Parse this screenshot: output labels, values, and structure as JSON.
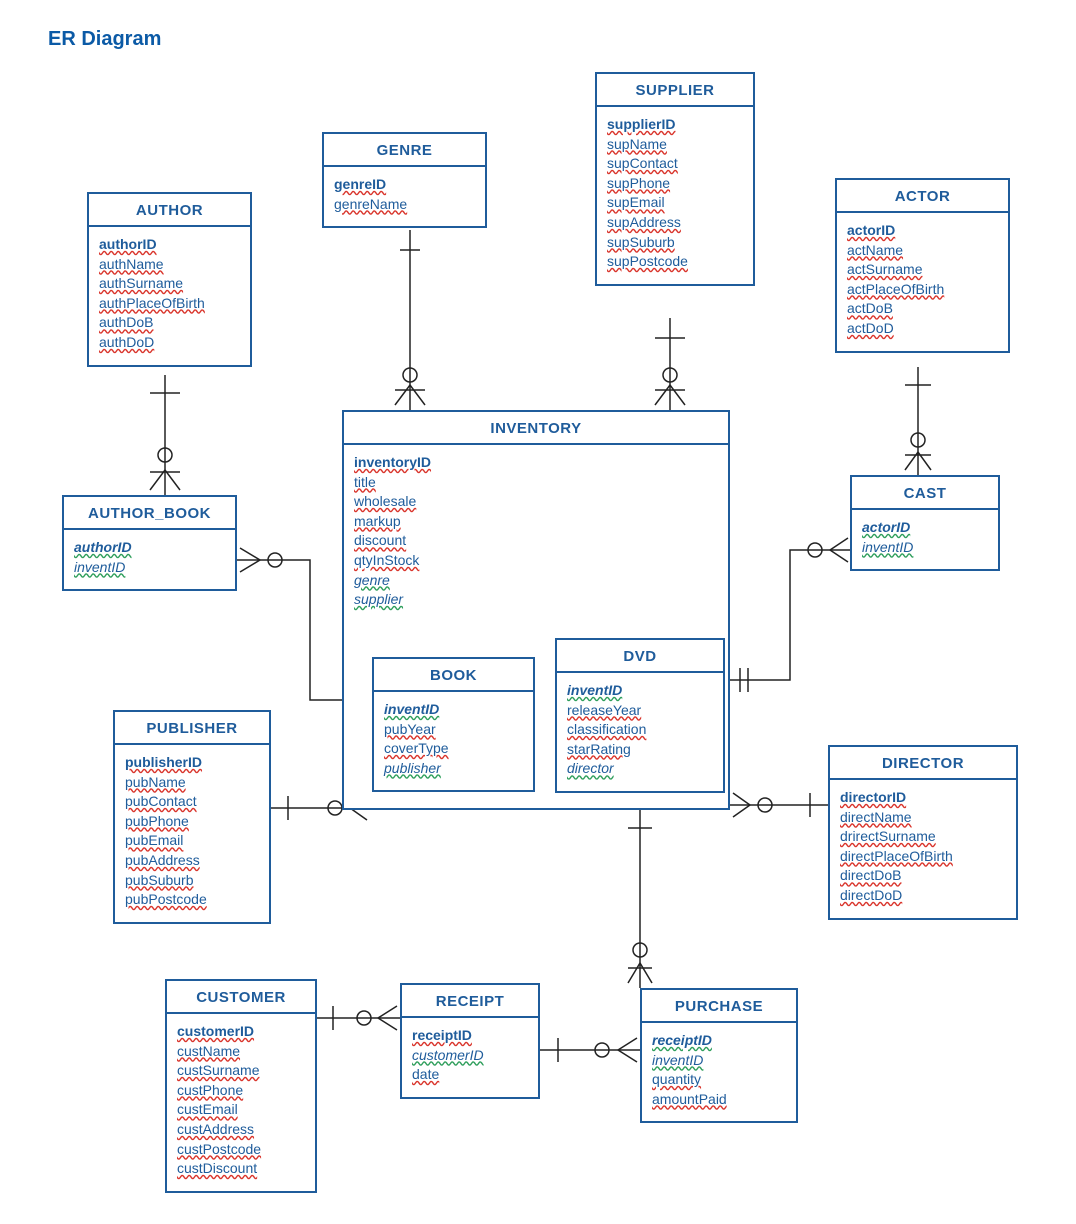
{
  "title": "ER Diagram",
  "entities": {
    "author": {
      "name": "AUTHOR",
      "attrs": [
        "authorID",
        "authName",
        "authSurname",
        "authPlaceOfBirth",
        "authDoB",
        "authDoD"
      ]
    },
    "author_book": {
      "name": "AUTHOR_BOOK",
      "attrs": [
        "authorID",
        "inventID"
      ]
    },
    "genre": {
      "name": "GENRE",
      "attrs": [
        "genreID",
        "genreName"
      ]
    },
    "supplier": {
      "name": "SUPPLIER",
      "attrs": [
        "supplierID",
        "supName",
        "supContact",
        "supPhone",
        "supEmail",
        "supAddress",
        "supSuburb",
        "supPostcode"
      ]
    },
    "actor": {
      "name": "ACTOR",
      "attrs": [
        "actorID",
        "actName",
        "actSurname",
        "actPlaceOfBirth",
        "actDoB",
        "actDoD"
      ]
    },
    "cast": {
      "name": "CAST",
      "attrs": [
        "actorID",
        "inventID"
      ]
    },
    "inventory": {
      "name": "INVENTORY",
      "attrs": [
        "inventoryID",
        "title",
        "wholesale",
        "markup",
        "discount",
        "qtyInStock",
        "genre",
        "supplier"
      ]
    },
    "book": {
      "name": "BOOK",
      "attrs": [
        "inventID",
        "pubYear",
        "coverType",
        "publisher"
      ]
    },
    "dvd": {
      "name": "DVD",
      "attrs": [
        "inventID",
        "releaseYear",
        "classification",
        "starRating",
        "director"
      ]
    },
    "publisher": {
      "name": "PUBLISHER",
      "attrs": [
        "publisherID",
        "pubName",
        "pubContact",
        "pubPhone",
        "pubEmail",
        "pubAddress",
        "pubSuburb",
        "pubPostcode"
      ]
    },
    "director": {
      "name": "DIRECTOR",
      "attrs": [
        "directorID",
        "directName",
        "drirectSurname",
        "directPlaceOfBirth",
        "directDoB",
        "directDoD"
      ]
    },
    "customer": {
      "name": "CUSTOMER",
      "attrs": [
        "customerID",
        "custName",
        "custSurname",
        "custPhone",
        "custEmail",
        "custAddress",
        "custPostcode",
        "custDiscount"
      ]
    },
    "receipt": {
      "name": "RECEIPT",
      "attrs": [
        "receiptID",
        "customerID",
        "date"
      ]
    },
    "purchase": {
      "name": "PURCHASE",
      "attrs": [
        "receiptID",
        "inventID",
        "quantity",
        "amountPaid"
      ]
    }
  }
}
